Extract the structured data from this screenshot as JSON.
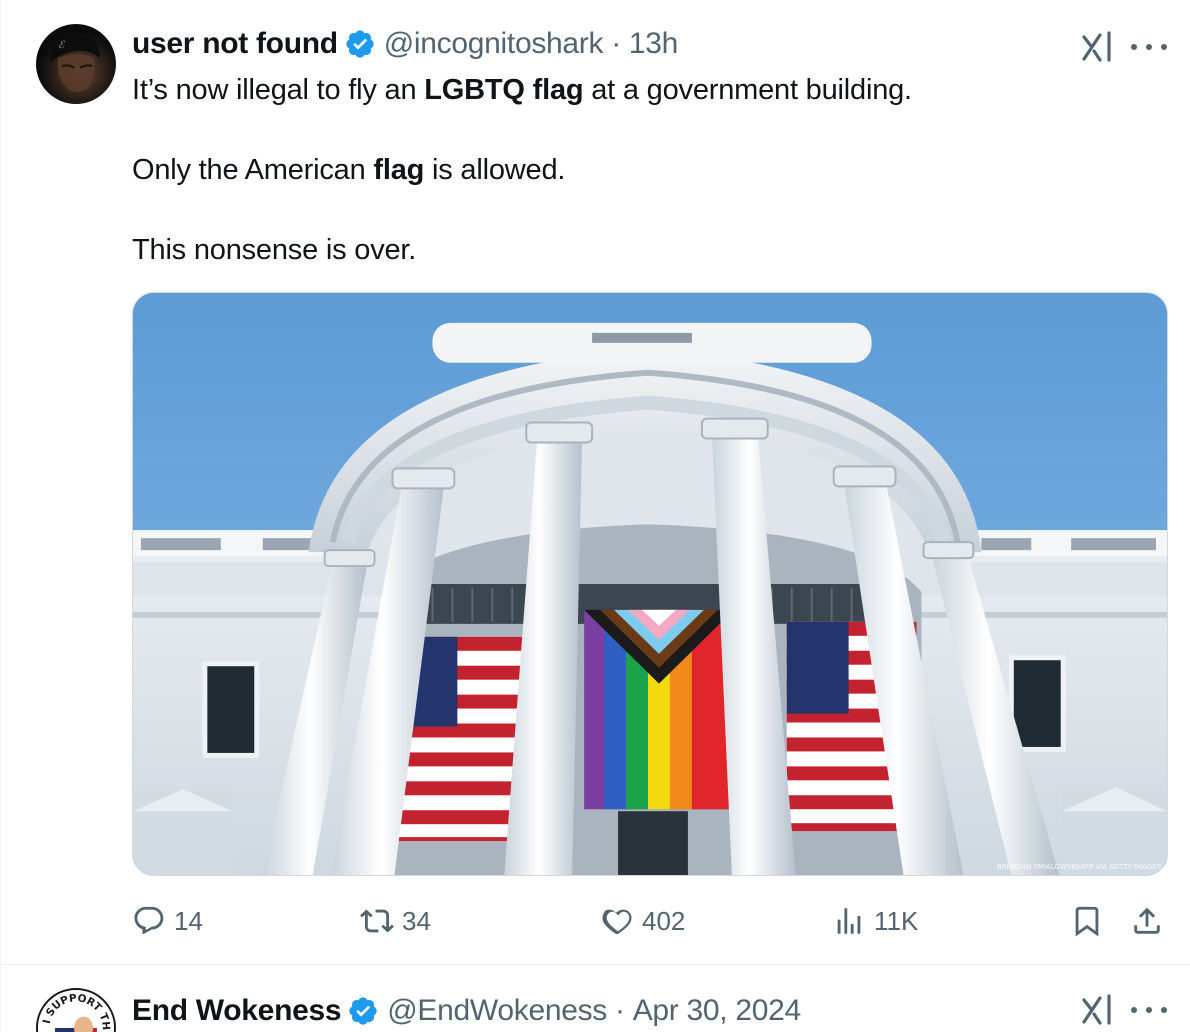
{
  "tweets": [
    {
      "display_name": "user not found",
      "handle": "@incognitoshark",
      "separator": "·",
      "time": "13h",
      "text": {
        "line1_before": "It’s now illegal to fly an ",
        "line1_bold": "LGBTQ flag",
        "line1_after": " at a government building.",
        "line2_before": "Only the American ",
        "line2_bold": "flag",
        "line2_after": " is allowed.",
        "line3": "This nonsense is over."
      },
      "media": {
        "photo_credit": "BRENDAN SMIALOWSKI/AFP VIA GETTY IMAGES"
      },
      "stats": {
        "replies": "14",
        "reposts": "34",
        "likes": "402",
        "views": "11K"
      }
    },
    {
      "display_name": "End Wokeness",
      "handle": "@EndWokeness",
      "separator": "·",
      "time": "Apr 30, 2024",
      "avatar_text": "I SUPPORT THE"
    }
  ],
  "icons": {
    "verified": "verified-badge-icon",
    "grok": "grok-icon",
    "more": "more-icon",
    "reply": "reply-icon",
    "repost": "repost-icon",
    "like": "like-icon",
    "views": "views-icon",
    "bookmark": "bookmark-icon",
    "share": "share-icon"
  },
  "colors": {
    "verified": "#1d9bf0",
    "text": "#0f1419",
    "secondary": "#536471",
    "border": "#eff3f4"
  }
}
